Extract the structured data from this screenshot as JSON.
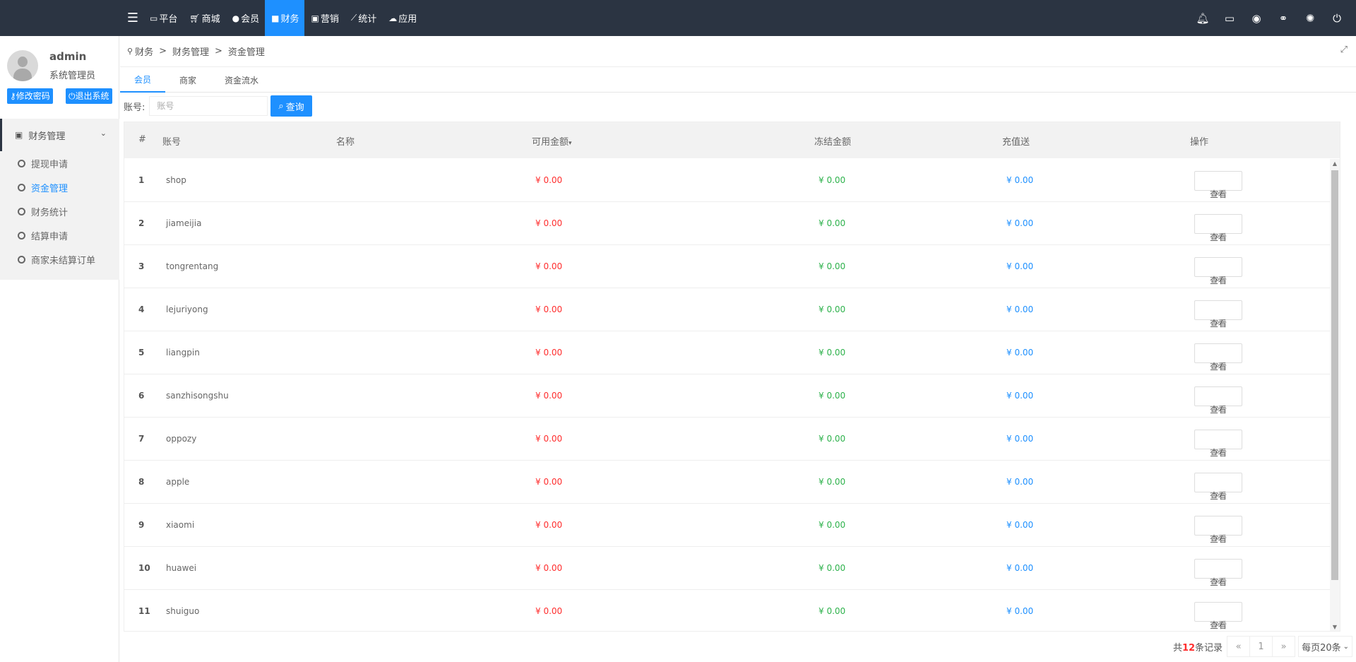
{
  "topnav": {
    "items": [
      {
        "label": "平台",
        "icon": "monitor-icon"
      },
      {
        "label": "商城",
        "icon": "cart-icon"
      },
      {
        "label": "会员",
        "icon": "user-icon"
      },
      {
        "label": "财务",
        "icon": "truck-icon"
      },
      {
        "label": "营销",
        "icon": "gift-icon"
      },
      {
        "label": "统计",
        "icon": "chart-icon"
      },
      {
        "label": "应用",
        "icon": "cloud-icon"
      }
    ],
    "active_index": 3,
    "accent_color": "#1e90ff",
    "bar_color": "#2b3442"
  },
  "user": {
    "name": "admin",
    "role": "系统管理员",
    "change_password": "修改密码",
    "logout": "退出系统"
  },
  "sidebar": {
    "group_label": "财务管理",
    "items": [
      {
        "label": "提现申请"
      },
      {
        "label": "资金管理"
      },
      {
        "label": "财务统计"
      },
      {
        "label": "结算申请"
      },
      {
        "label": "商家未结算订单"
      }
    ],
    "active_index": 1
  },
  "breadcrumb": {
    "items": [
      "财务",
      "财务管理",
      "资金管理"
    ],
    "separator": ">"
  },
  "tabs": {
    "items": [
      "会员",
      "商家",
      "资金流水"
    ],
    "active_index": 0
  },
  "search": {
    "label": "账号:",
    "placeholder": "账号",
    "button_label": "查询"
  },
  "table": {
    "columns": [
      "#",
      "账号",
      "名称",
      "可用金额",
      "冻结金额",
      "充值送",
      "操作"
    ],
    "sort_indicator": "▾",
    "rows": [
      {
        "num": "1",
        "account": "shop",
        "name": "",
        "available": "¥ 0.00",
        "frozen": "¥ 0.00",
        "gift": "¥ 0.00",
        "action": "查看"
      },
      {
        "num": "2",
        "account": "jiameijia",
        "name": "",
        "available": "¥ 0.00",
        "frozen": "¥ 0.00",
        "gift": "¥ 0.00",
        "action": "查看"
      },
      {
        "num": "3",
        "account": "tongrentang",
        "name": "",
        "available": "¥ 0.00",
        "frozen": "¥ 0.00",
        "gift": "¥ 0.00",
        "action": "查看"
      },
      {
        "num": "4",
        "account": "lejuriyong",
        "name": "",
        "available": "¥ 0.00",
        "frozen": "¥ 0.00",
        "gift": "¥ 0.00",
        "action": "查看"
      },
      {
        "num": "5",
        "account": "liangpin",
        "name": "",
        "available": "¥ 0.00",
        "frozen": "¥ 0.00",
        "gift": "¥ 0.00",
        "action": "查看"
      },
      {
        "num": "6",
        "account": "sanzhisongshu",
        "name": "",
        "available": "¥ 0.00",
        "frozen": "¥ 0.00",
        "gift": "¥ 0.00",
        "action": "查看"
      },
      {
        "num": "7",
        "account": "oppozy",
        "name": "",
        "available": "¥ 0.00",
        "frozen": "¥ 0.00",
        "gift": "¥ 0.00",
        "action": "查看"
      },
      {
        "num": "8",
        "account": "apple",
        "name": "",
        "available": "¥ 0.00",
        "frozen": "¥ 0.00",
        "gift": "¥ 0.00",
        "action": "查看"
      },
      {
        "num": "9",
        "account": "xiaomi",
        "name": "",
        "available": "¥ 0.00",
        "frozen": "¥ 0.00",
        "gift": "¥ 0.00",
        "action": "查看"
      },
      {
        "num": "10",
        "account": "huawei",
        "name": "",
        "available": "¥ 0.00",
        "frozen": "¥ 0.00",
        "gift": "¥ 0.00",
        "action": "查看"
      },
      {
        "num": "11",
        "account": "shuiguo",
        "name": "",
        "available": "¥ 0.00",
        "frozen": "¥ 0.00",
        "gift": "¥ 0.00",
        "action": "查看"
      }
    ]
  },
  "pager": {
    "prefix": "共",
    "total": "12",
    "suffix": "条记录",
    "prev": "«",
    "page": "1",
    "next": "»",
    "per_page": "每页20条"
  },
  "colors": {
    "available": "#ff2d2d",
    "frozen": "#2eb24c",
    "gift": "#1e90ff"
  }
}
